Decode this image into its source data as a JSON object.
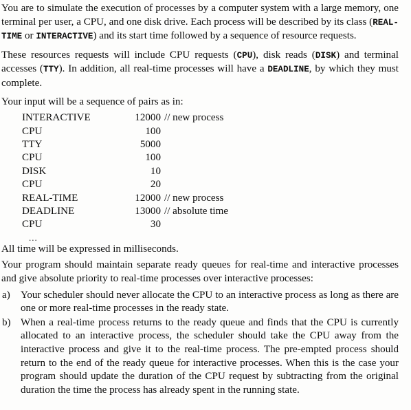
{
  "document": {
    "paragraphs": {
      "intro_1": "You are to simulate the execution of processes by a computer system with a large memory, one terminal per user, a CPU, and one disk drive. Each process will be described by its class (",
      "intro_1_code_a": "REAL-TIME",
      "intro_1_mid": " or ",
      "intro_1_code_b": "INTERACTIVE",
      "intro_1_end": ") and its start time followed by a sequence of resource requests.",
      "intro_2_a": "These resources requests will include CPU requests (",
      "intro_2_code_a": "CPU",
      "intro_2_b": "), disk reads (",
      "intro_2_code_b": "DISK",
      "intro_2_c": ") and terminal accesses (",
      "intro_2_code_c": "TTY",
      "intro_2_d": ").  In addition, all real-time processes will have a ",
      "intro_2_code_d": "DEADLINE",
      "intro_2_e": ", by which they must complete.",
      "input_lead": "Your input will be a sequence of pairs as in:",
      "ellipsis": "...",
      "milliseconds": "All time will be expressed in milliseconds.",
      "queues": "Your program should maintain separate ready queues for real-time and interactive processes and give absolute priority to real-time processes over interactive processes:"
    },
    "listing": {
      "rows": [
        {
          "keyword": "INTERACTIVE",
          "value": "12000",
          "comment": "// new process"
        },
        {
          "keyword": "CPU",
          "value": "100",
          "comment": ""
        },
        {
          "keyword": "TTY",
          "value": "5000",
          "comment": ""
        },
        {
          "keyword": "CPU",
          "value": "100",
          "comment": ""
        },
        {
          "keyword": "DISK",
          "value": "10",
          "comment": ""
        },
        {
          "keyword": "CPU",
          "value": "20",
          "comment": ""
        },
        {
          "keyword": "REAL-TIME",
          "value": "12000",
          "comment": "// new process"
        },
        {
          "keyword": "DEADLINE",
          "value": "13000",
          "comment": "// absolute time"
        },
        {
          "keyword": "CPU",
          "value": "30",
          "comment": ""
        }
      ]
    },
    "lettered_list": [
      {
        "marker": "a)",
        "text": "Your scheduler should never allocate the CPU to an interactive process as long as there are one or more real-time processes in the ready state."
      },
      {
        "marker": "b)",
        "text": "When a real-time process returns to the ready queue and finds that the CPU is currently allocated to an interactive process, the scheduler should take the CPU away from the interactive process and give it to the real-time process.  The pre-empted process should return to the end of the ready queue for interactive processes.  When this is the case your program should update the duration of the CPU request by subtracting from the original duration the time the process has already spent in the running state."
      }
    ]
  }
}
